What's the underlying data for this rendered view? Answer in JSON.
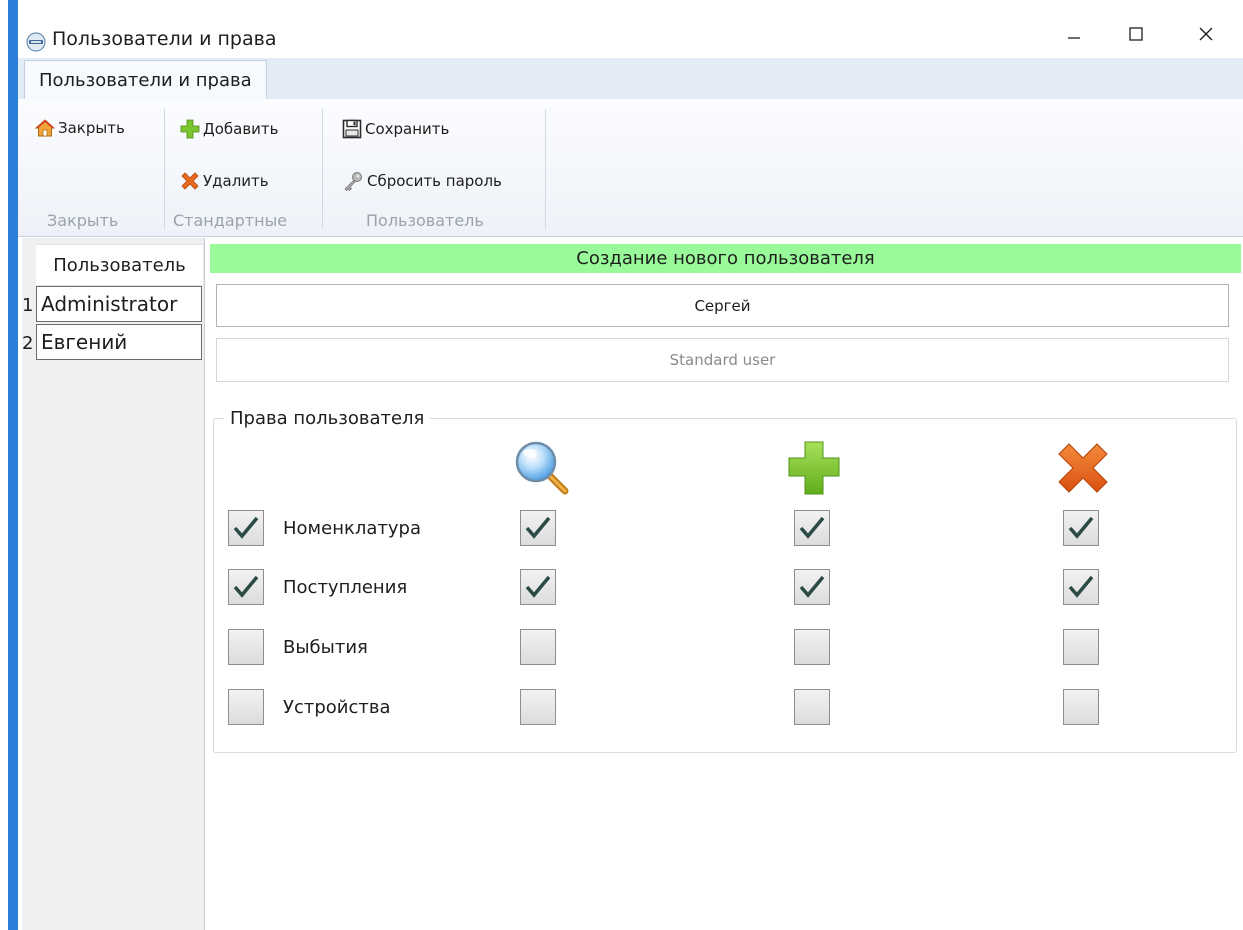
{
  "window": {
    "title": "Пользователи и права",
    "icon": "app-logo-icon",
    "controls": {
      "minimize": "minimize-icon",
      "maximize": "maximize-icon",
      "close": "close-icon"
    },
    "accent_color": "#2b7fd9"
  },
  "ribbon": {
    "tabs": [
      {
        "label": "Пользователи и права",
        "active": true
      }
    ],
    "groups": [
      {
        "label": "Закрыть",
        "buttons": [
          {
            "label": "Закрыть",
            "icon": "home-icon"
          }
        ]
      },
      {
        "label": "Стандартные",
        "buttons": [
          {
            "label": "Добавить",
            "icon": "plus-icon"
          },
          {
            "label": "Удалить",
            "icon": "delete-x-icon"
          }
        ]
      },
      {
        "label": "Пользователь",
        "buttons": [
          {
            "label": "Сохранить",
            "icon": "save-icon"
          },
          {
            "label": "Сбросить пароль",
            "icon": "key-icon"
          }
        ]
      }
    ]
  },
  "users": {
    "column_header": "Пользователь",
    "rows": [
      {
        "num": "1",
        "name": "Administrator"
      },
      {
        "num": "2",
        "name": "Евгений"
      }
    ]
  },
  "editor": {
    "status_text": "Создание нового пользователя",
    "status_color": "#98fa98",
    "name_value": "Сергей",
    "role_placeholder": "Standard user",
    "rights": {
      "legend": "Права пользователя",
      "columns": [
        {
          "icon": "magnifier-icon",
          "meaning": "view"
        },
        {
          "icon": "plus-icon",
          "meaning": "add"
        },
        {
          "icon": "delete-x-icon",
          "meaning": "delete"
        }
      ],
      "rows": [
        {
          "label": "Номенклатура",
          "enabled": true,
          "view": true,
          "add": true,
          "delete": true
        },
        {
          "label": "Поступления",
          "enabled": true,
          "view": true,
          "add": true,
          "delete": true
        },
        {
          "label": "Выбытия",
          "enabled": false,
          "view": false,
          "add": false,
          "delete": false
        },
        {
          "label": "Устройства",
          "enabled": false,
          "view": false,
          "add": false,
          "delete": false
        }
      ]
    }
  }
}
